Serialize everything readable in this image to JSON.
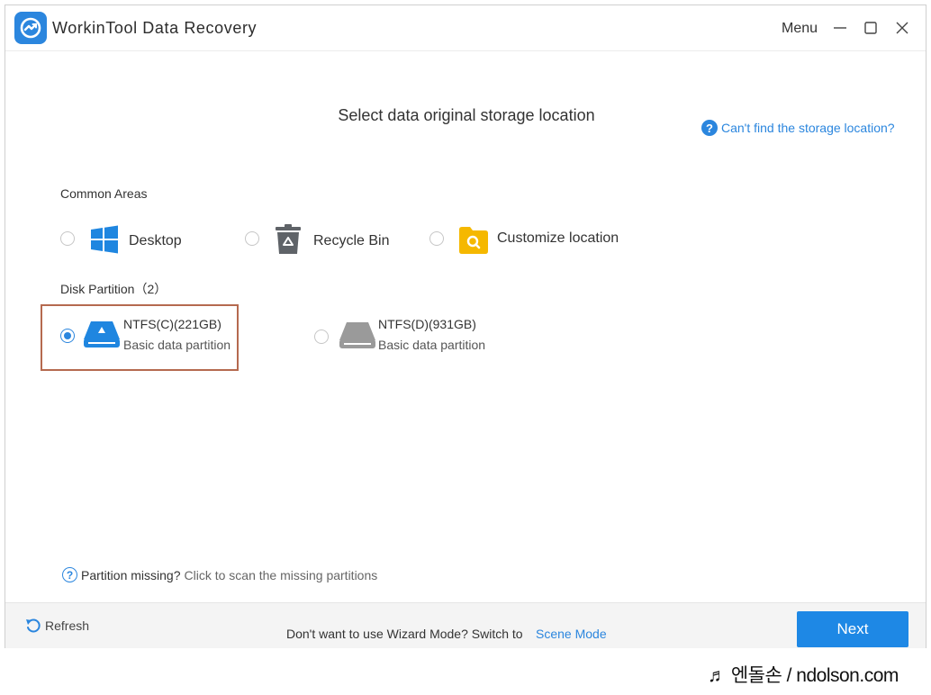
{
  "window": {
    "title": "WorkinTool Data Recovery",
    "menu_label": "Menu"
  },
  "main": {
    "title": "Select data original storage location",
    "help_link": "Can't find the storage location?",
    "common_areas": {
      "label": "Common Areas",
      "options": [
        {
          "label": "Desktop",
          "icon": "windows-icon",
          "checked": false
        },
        {
          "label": "Recycle Bin",
          "icon": "recycle-bin-icon",
          "checked": false
        },
        {
          "label": "Customize location",
          "icon": "folder-search-icon",
          "checked": false
        }
      ]
    },
    "disk_partition": {
      "label": "Disk Partition（2）",
      "partitions": [
        {
          "name": "NTFS(C)(221GB)",
          "description": "Basic data partition",
          "checked": true,
          "icon": "hard-drive-icon"
        },
        {
          "name": "NTFS(D)(931GB)",
          "description": "Basic data partition",
          "checked": false,
          "icon": "hard-drive-icon"
        }
      ]
    },
    "missing": {
      "prefix": "Partition missing?",
      "link": "Click to scan the missing partitions"
    }
  },
  "footer": {
    "refresh_label": "Refresh",
    "wizard_text": "Don't want to use Wizard Mode? Switch to",
    "scene_mode_link": "Scene Mode",
    "next_label": "Next"
  },
  "watermark": "♬ 엔돌손 / ndolson.com",
  "colors": {
    "accent": "#2b86de",
    "next_button": "#1e88e5",
    "highlight_border": "#b56a4f",
    "folder": "#f5b800",
    "drive_gray": "#9a9a9a"
  }
}
